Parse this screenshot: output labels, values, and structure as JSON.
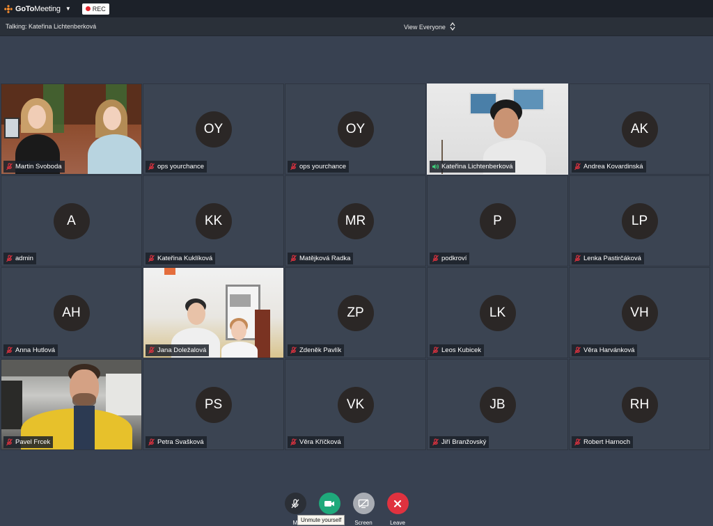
{
  "app": {
    "brand_bold": "GoTo",
    "brand_light": "Meeting",
    "rec_label": "REC"
  },
  "status": {
    "talking": "Talking: Kateřina Lichtenberková",
    "view": "View Everyone"
  },
  "participants": [
    {
      "name": "Martin Svoboda",
      "initials": "",
      "video": true,
      "mic": "off"
    },
    {
      "name": "ops yourchance",
      "initials": "OY",
      "video": false,
      "mic": "off"
    },
    {
      "name": "ops yourchance",
      "initials": "OY",
      "video": false,
      "mic": "off"
    },
    {
      "name": "Kateřina Lichtenberková",
      "initials": "",
      "video": true,
      "mic": "on"
    },
    {
      "name": "Andrea Kovardinská",
      "initials": "AK",
      "video": false,
      "mic": "off"
    },
    {
      "name": "admin",
      "initials": "A",
      "video": false,
      "mic": "off"
    },
    {
      "name": "Kateřina Kuklíková",
      "initials": "KK",
      "video": false,
      "mic": "off"
    },
    {
      "name": "Matějková Radka",
      "initials": "MR",
      "video": false,
      "mic": "off"
    },
    {
      "name": "podkroví",
      "initials": "P",
      "video": false,
      "mic": "off"
    },
    {
      "name": "Lenka Pastirčáková",
      "initials": "LP",
      "video": false,
      "mic": "off"
    },
    {
      "name": "Anna Hutlová",
      "initials": "AH",
      "video": false,
      "mic": "off"
    },
    {
      "name": "Jana Doležalová",
      "initials": "",
      "video": true,
      "mic": "off"
    },
    {
      "name": "Zdeněk Pavlík",
      "initials": "ZP",
      "video": false,
      "mic": "off"
    },
    {
      "name": "Leos Kubicek",
      "initials": "LK",
      "video": false,
      "mic": "off"
    },
    {
      "name": "Věra Harvánková",
      "initials": "VH",
      "video": false,
      "mic": "off"
    },
    {
      "name": "Pavel Frcek",
      "initials": "",
      "video": true,
      "mic": "off"
    },
    {
      "name": "Petra Svašková",
      "initials": "PS",
      "video": false,
      "mic": "off"
    },
    {
      "name": "Věra Kříčková",
      "initials": "VK",
      "video": false,
      "mic": "off"
    },
    {
      "name": "Jiří Branžovský",
      "initials": "JB",
      "video": false,
      "mic": "off"
    },
    {
      "name": "Robert Harnoch",
      "initials": "RH",
      "video": false,
      "mic": "off"
    }
  ],
  "controls": {
    "mic_label": "M",
    "camera_label": "",
    "screen_label": "Screen",
    "leave_label": "Leave",
    "tooltip": "Unmute yourself"
  },
  "colors": {
    "background": "#384151",
    "tile": "#3b4452",
    "avatar": "#2b2726",
    "camera_on": "#1fa97b",
    "screen": "#a8acb3",
    "leave": "#e0323f",
    "mic_off_red": "#e0323f",
    "mic_on_green": "#3ecf7a",
    "brand_orange": "#f68d2e"
  }
}
